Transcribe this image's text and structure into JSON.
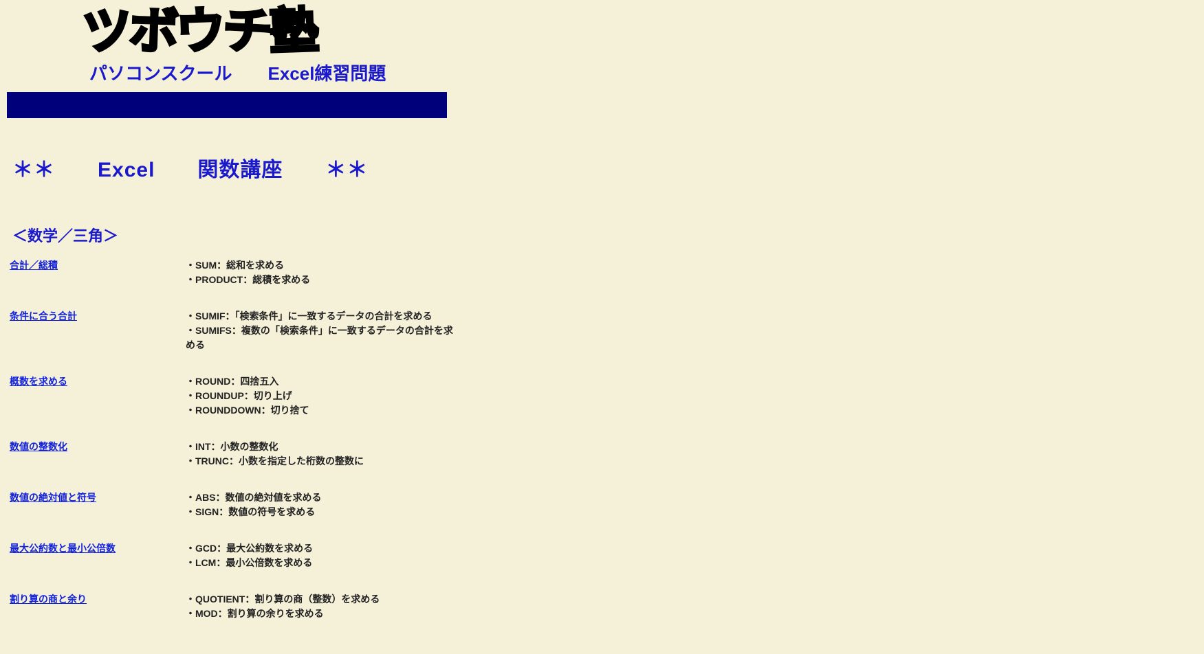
{
  "header": {
    "logo_chars": [
      "ツ",
      "ボ",
      "ウ",
      "チ",
      "塾"
    ],
    "subtitle": "パソコンスクール　　Excel練習問題"
  },
  "page_title": "＊＊　　Excel　　関数講座　　＊＊",
  "section": {
    "title": "＜数学／三角＞",
    "items": [
      {
        "link": "合計／総積",
        "lines": [
          "・SUM：総和を求める",
          "・PRODUCT：総積を求める"
        ]
      },
      {
        "link": "条件に合う合計",
        "lines": [
          "・SUMIF：「検索条件」に一致するデータの合計を求める",
          "・SUMIFS：複数の「検索条件」に一致するデータの合計を求める"
        ]
      },
      {
        "link": "概数を求める",
        "lines": [
          "・ROUND：四捨五入",
          "・ROUNDUP：切り上げ",
          "・ROUNDDOWN：切り捨て"
        ]
      },
      {
        "link": "数値の整数化",
        "lines": [
          "・INT：小数の整数化",
          "・TRUNC：小数を指定した桁数の整数に"
        ]
      },
      {
        "link": "数値の絶対値と符号",
        "lines": [
          "・ABS：数値の絶対値を求める",
          "・SIGN：数値の符号を求める"
        ]
      },
      {
        "link": "最大公約数と最小公倍数",
        "lines": [
          "・GCD：最大公約数を求める",
          "・LCM：最小公倍数を求める"
        ]
      },
      {
        "link": "割り算の商と余り",
        "lines": [
          "・QUOTIENT：割り算の商（整数）を求める",
          "・MOD：割り算の余りを求める"
        ]
      }
    ]
  }
}
